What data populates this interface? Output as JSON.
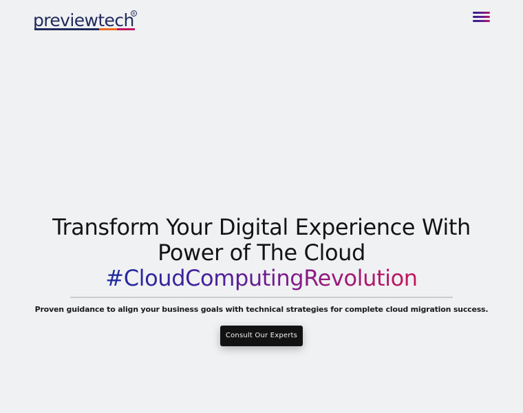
{
  "header": {
    "logo_text": "previewtech",
    "logo_registered": "R",
    "menu_icon": "hamburger-menu-icon"
  },
  "hero": {
    "title_line_1": "Transform Your Digital Experience With",
    "title_line_2": "Power of The Cloud",
    "hashtag": "#CloudComputingRevolution",
    "subtitle": "Proven guidance to align your business goals with technical strategies for complete cloud migration success.",
    "cta_label": "Consult Our Experts"
  },
  "colors": {
    "background": "#f0f1f3",
    "logo_blue": "#1f2a5c",
    "logo_orange": "#f06a1d",
    "logo_magenta": "#c0145e",
    "hashtag_start": "#1e2ba0",
    "hashtag_end": "#c8145a",
    "cta_background": "#121212"
  }
}
